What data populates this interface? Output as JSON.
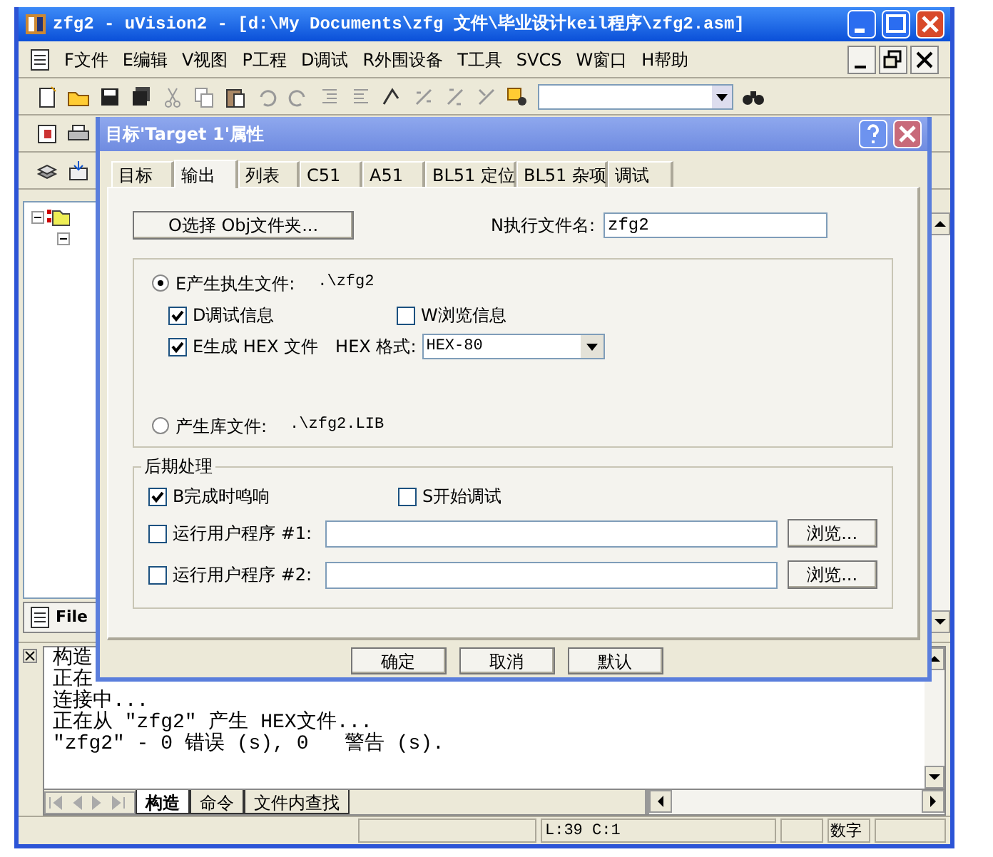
{
  "window": {
    "title": "zfg2  - uVision2 - [d:\\My Documents\\zfg 文件\\毕业设计keil程序\\zfg2.asm]"
  },
  "menu": [
    "F文件",
    "E编辑",
    "V视图",
    "P工程",
    "D调试",
    "R外围设备",
    "T工具",
    "SVCS",
    "W窗口",
    "H帮助"
  ],
  "project_panel": {
    "tab": "File"
  },
  "output": {
    "lines": [
      "构造",
      "正在",
      "连接中...",
      "正在从 \"zfg2\" 产生 HEX文件...",
      "\"zfg2\" - 0 错误 (s), 0   警告 (s)."
    ],
    "tabs": [
      {
        "label": "构造",
        "selected": true
      },
      {
        "label": "命令",
        "selected": false
      },
      {
        "label": "文件内查找",
        "selected": false
      }
    ]
  },
  "status_bar": {
    "position": "L:39 C:1",
    "mode": "数字"
  },
  "dialog": {
    "title": "目标'Target 1'属性",
    "tabs": [
      {
        "label": "目标",
        "selected": false
      },
      {
        "label": "输出",
        "selected": true
      },
      {
        "label": "列表",
        "selected": false
      },
      {
        "label": "C51",
        "selected": false
      },
      {
        "label": "A51",
        "selected": false
      },
      {
        "label": "BL51 定位",
        "selected": false
      },
      {
        "label": "BL51 杂项",
        "selected": false
      },
      {
        "label": "调试",
        "selected": false
      }
    ],
    "select_obj_button": "O选择 Obj文件夹...",
    "exe_name_label": "N执行文件名:",
    "exe_name_value": "zfg2",
    "create_exe": {
      "label": "E产生执生文件:",
      "path": ".\\zfg2",
      "selected": true
    },
    "options": [
      {
        "label": "D调试信息",
        "checked": true
      },
      {
        "label": "W浏览信息",
        "checked": false
      }
    ],
    "hex": {
      "label": "E生成 HEX 文件",
      "checked": true,
      "format_label": "HEX 格式:",
      "format_value": "HEX-80"
    },
    "create_lib": {
      "label": "产生库文件:",
      "path": ".\\zfg2.LIB",
      "selected": false
    },
    "post": {
      "title": "后期处理",
      "options": [
        {
          "label": "B完成时鸣响",
          "checked": true
        },
        {
          "label": "S开始调试",
          "checked": false
        }
      ],
      "user_programs": [
        {
          "label": "运行用户程序 #1:",
          "checked": false,
          "browse": "浏览..."
        },
        {
          "label": "运行用户程序 #2:",
          "checked": false,
          "browse": "浏览..."
        }
      ]
    },
    "buttons": [
      "确定",
      "取消",
      "默认"
    ]
  }
}
